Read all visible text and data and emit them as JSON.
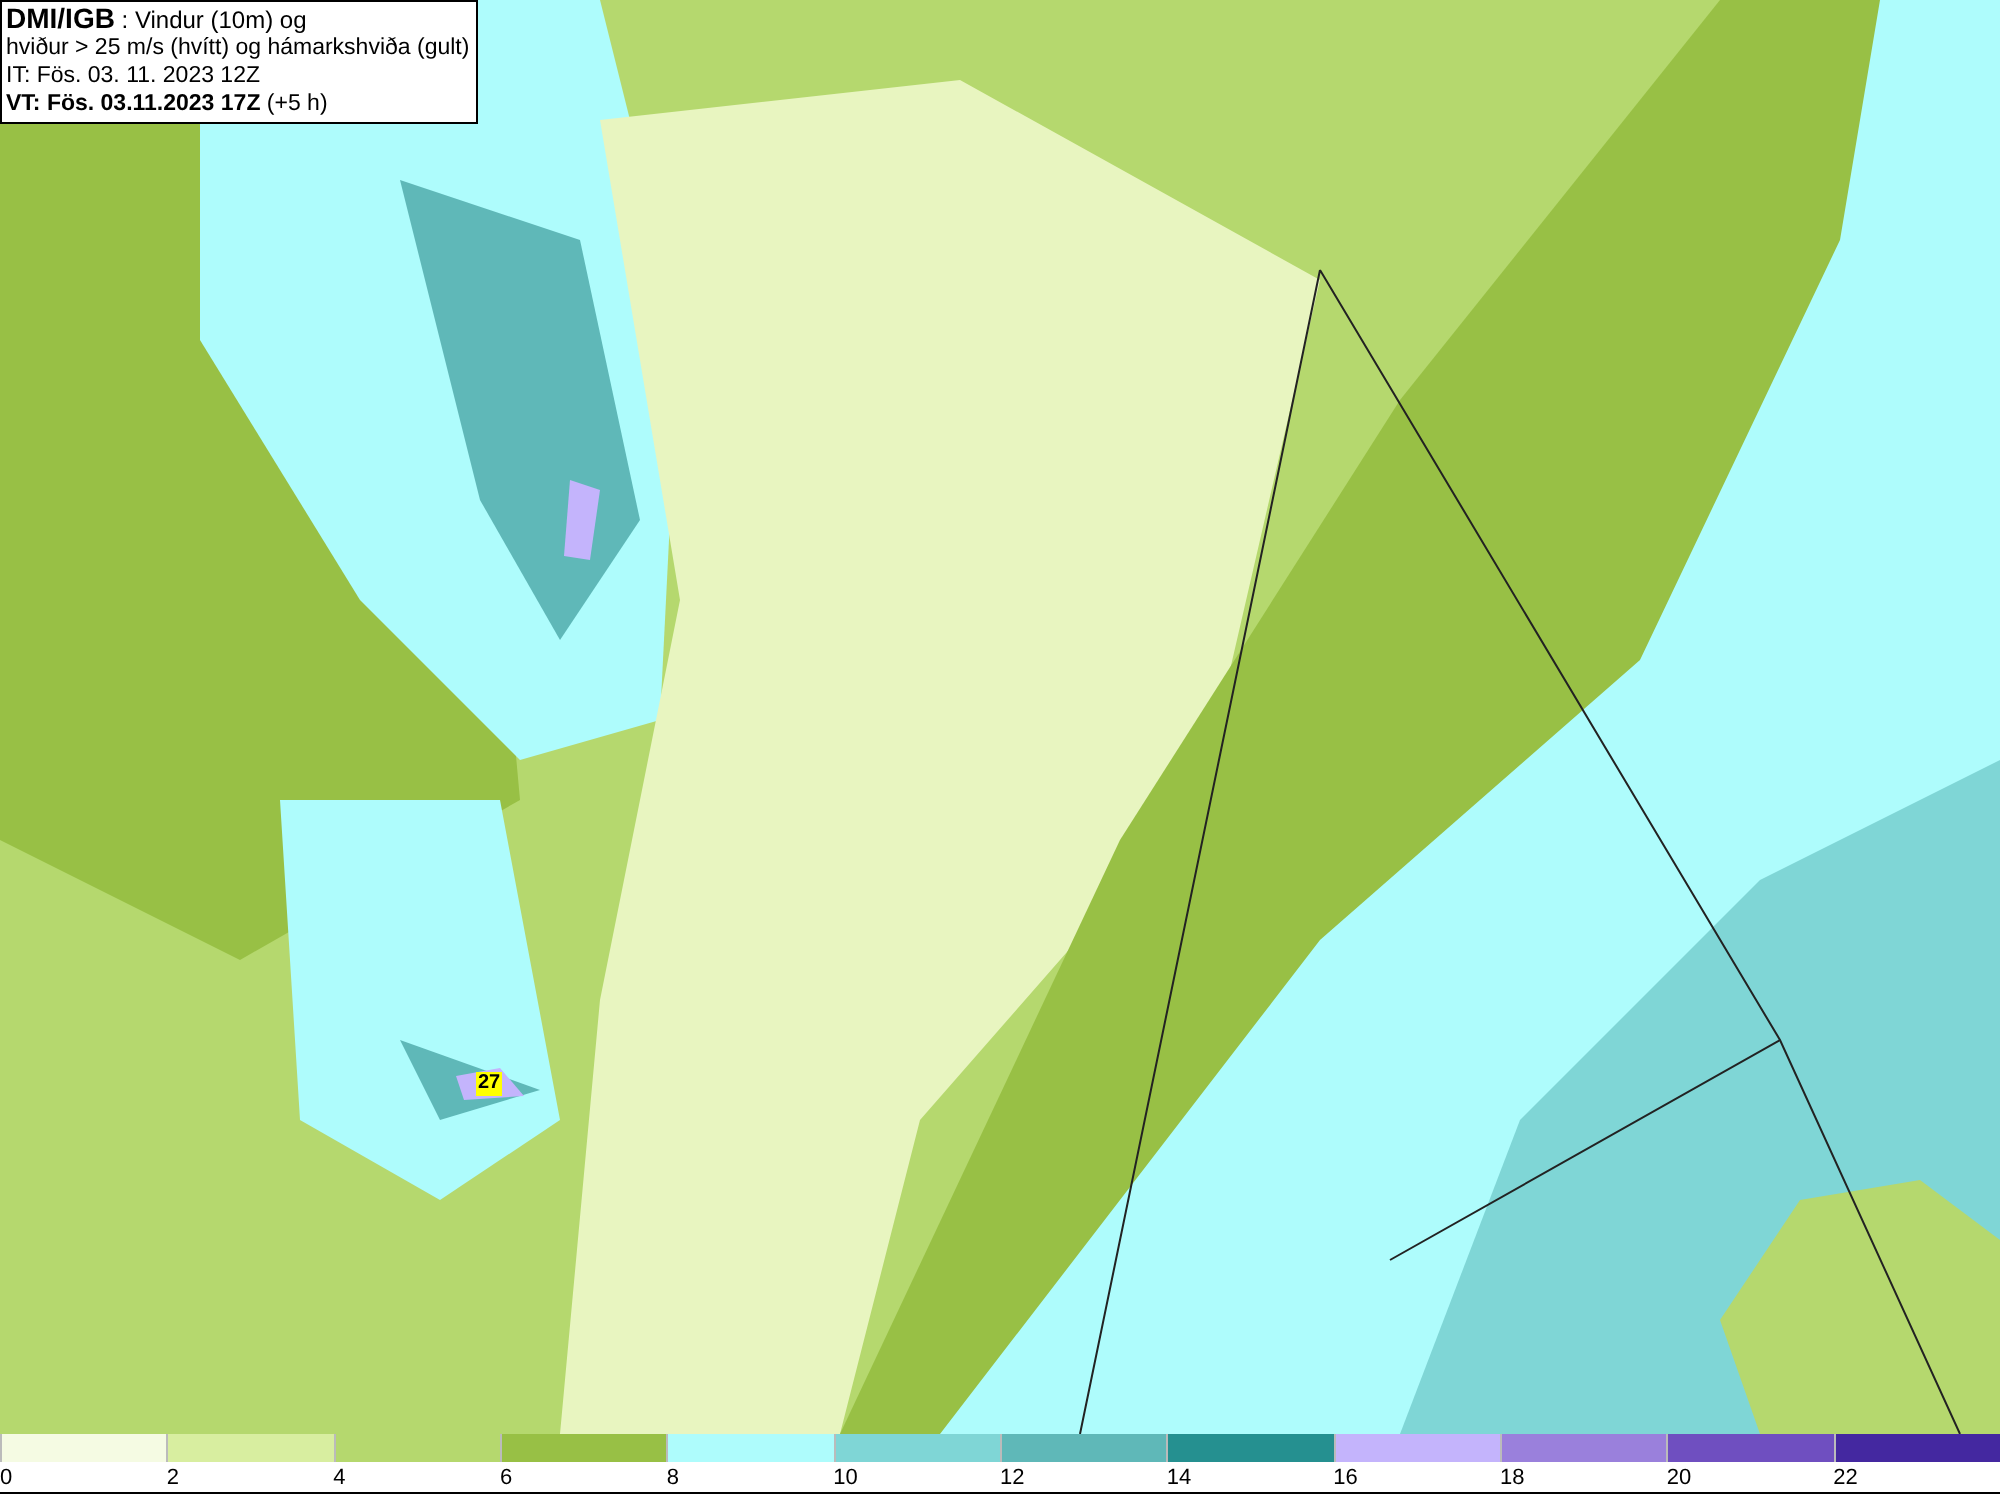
{
  "header": {
    "lines": [
      "**DMI/IGB** : Vindur (10m) og",
      "hviður > 25 m/s (hvítt) og hámarkshviða (gult)",
      "IT: Fös. 03. 11. 2023 12Z",
      "**VT: Fös. 03.11.2023 17Z** (+5 h)"
    ]
  },
  "map": {
    "max_gust": "27"
  },
  "legend": [
    {
      "label": "0",
      "color": "#f5fbe3"
    },
    {
      "label": "2",
      "color": "#d8eea0"
    },
    {
      "label": "4",
      "color": "#b5d86e"
    },
    {
      "label": "6",
      "color": "#98c045"
    },
    {
      "label": "8",
      "color": "#aefcfc"
    },
    {
      "label": "10",
      "color": "#7fd6d6"
    },
    {
      "label": "12",
      "color": "#5fb8b8"
    },
    {
      "label": "14",
      "color": "#259090"
    },
    {
      "label": "16",
      "color": "#c4b4fc"
    },
    {
      "label": "18",
      "color": "#9a80dc"
    },
    {
      "label": "20",
      "color": "#6f4fc0"
    },
    {
      "label": "22",
      "color": "#4428a0"
    }
  ]
}
